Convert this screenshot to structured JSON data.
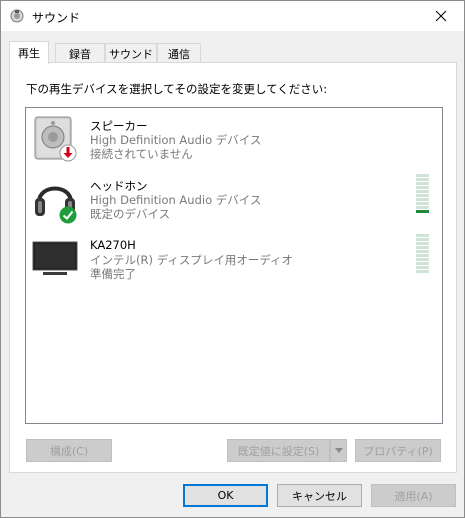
{
  "window": {
    "title": "サウンド"
  },
  "tabs": [
    {
      "label": "再生"
    },
    {
      "label": "録音"
    },
    {
      "label": "サウンド"
    },
    {
      "label": "通信"
    }
  ],
  "panel": {
    "instruction": "下の再生デバイスを選択してその設定を変更してください:"
  },
  "devices": [
    {
      "name": "スピーカー",
      "description": "High Definition Audio デバイス",
      "status": "接続されていません",
      "icon": "speaker-icon",
      "badge": "disconnected-badge-icon"
    },
    {
      "name": "ヘッドホン",
      "description": "High Definition Audio デバイス",
      "status": "既定のデバイス",
      "icon": "headphones-icon",
      "badge": "default-check-badge-icon",
      "level": 0.08
    },
    {
      "name": "KA270H",
      "description": "インテル(R) ディスプレイ用オーディオ",
      "status": "準備完了",
      "icon": "monitor-icon",
      "level": 0
    }
  ],
  "buttons": {
    "configure": "構成(C)",
    "set_default": "既定値に設定(S)",
    "properties": "プロパティ(P)",
    "ok": "OK",
    "cancel": "キャンセル",
    "apply": "適用(A)"
  },
  "colors": {
    "accent": "#0078d7",
    "meter_on": "#1f8a3b",
    "check_green": "#1e9e3a",
    "disconnected_red": "#d9001b"
  }
}
